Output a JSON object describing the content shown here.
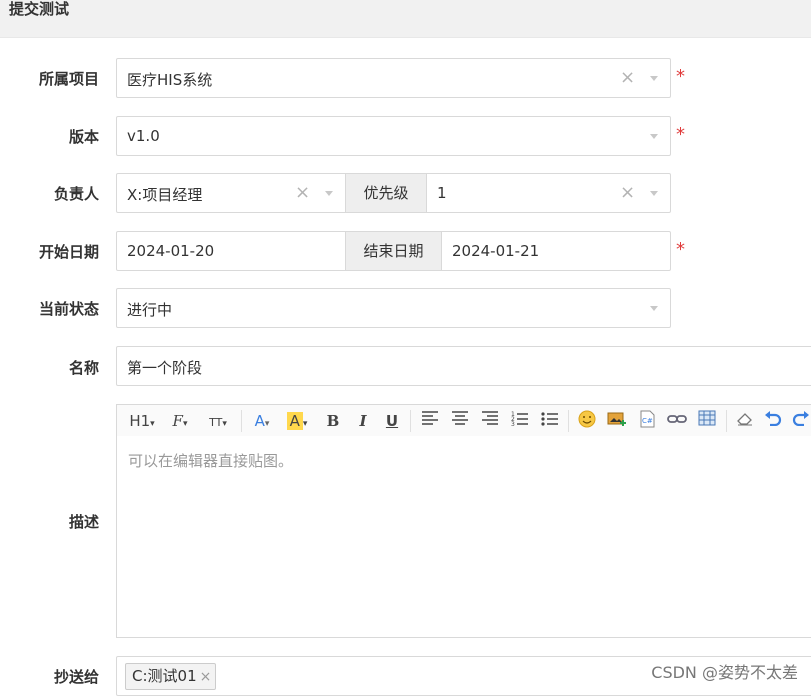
{
  "header": {
    "title": "提交测试"
  },
  "form": {
    "project": {
      "label": "所属项目",
      "value": "医疗HIS系统"
    },
    "version": {
      "label": "版本",
      "value": "v1.0"
    },
    "owner": {
      "label": "负责人",
      "value": "X:项目经理"
    },
    "priority": {
      "label": "优先级",
      "value": "1"
    },
    "start_date": {
      "label": "开始日期",
      "value": "2024-01-20"
    },
    "end_date": {
      "label": "结束日期",
      "value": "2024-01-21"
    },
    "status": {
      "label": "当前状态",
      "value": "进行中"
    },
    "name": {
      "label": "名称",
      "value": "第一个阶段"
    },
    "description": {
      "label": "描述",
      "placeholder": "可以在编辑器直接贴图。"
    },
    "cc": {
      "label": "抄送给",
      "tags": [
        "C:测试01"
      ]
    },
    "required_mark": "*",
    "clear_glyph": "×"
  },
  "toolbar": {
    "heading": "H1",
    "font_family": "F",
    "font_size": "TT",
    "font_color": "A",
    "bg_color": "A",
    "bold": "B",
    "italic": "I",
    "underline": "U",
    "icons": [
      "heading-icon",
      "font-family-icon",
      "font-size-icon",
      "font-color-icon",
      "highlight-icon",
      "bold-icon",
      "italic-icon",
      "underline-icon",
      "align-left-icon",
      "align-center-icon",
      "align-right-icon",
      "ordered-list-icon",
      "unordered-list-icon",
      "emoji-icon",
      "image-icon",
      "code-icon",
      "link-icon",
      "table-icon",
      "eraser-icon",
      "undo-icon",
      "redo-icon"
    ]
  },
  "watermark": "CSDN @姿势不太差",
  "colors": {
    "required": "#e03b3b",
    "header_bg": "#f1f1f1",
    "addon_bg": "#eeeeee",
    "highlight": "#ffd84d",
    "font_color_icon": "#3a7fe0"
  }
}
